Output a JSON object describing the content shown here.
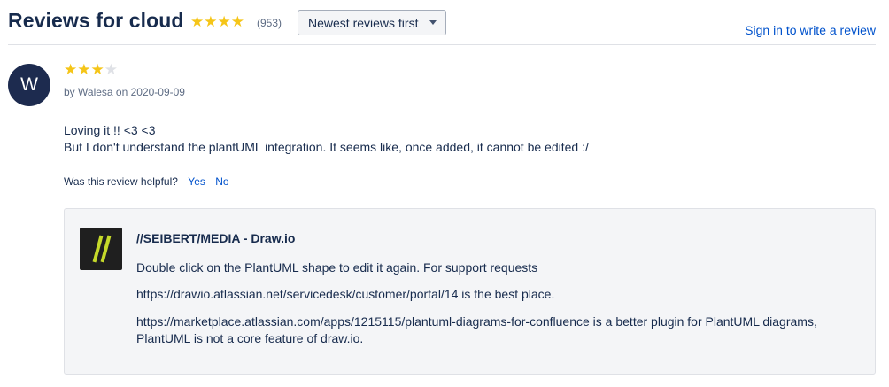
{
  "header": {
    "title": "Reviews for cloud",
    "stars": "★★★★",
    "count": "(953)",
    "sort": {
      "selected": "Newest reviews first"
    },
    "signin_label": "Sign in to write a review"
  },
  "review": {
    "avatar_initial": "W",
    "rating": 3,
    "rating_max": 4,
    "stars_on": "★★★",
    "stars_off": "★",
    "byline": "by Walesa on 2020-09-09",
    "body_line1": "Loving it !! <3 <3",
    "body_line2": "But I don't understand the plantUML integration. It seems like, once added, it cannot be edited :/",
    "helpful_prompt": "Was this review helpful?",
    "yes_label": "Yes",
    "no_label": "No"
  },
  "reply": {
    "vendor_name": "//SEIBERT/MEDIA - Draw.io",
    "paragraph1": "Double click on the PlantUML shape to edit it again. For support requests",
    "paragraph2": "https://drawio.atlassian.net/servicedesk/customer/portal/14 is the best place.",
    "paragraph3_line1": "https://marketplace.atlassian.com/apps/1215115/plantuml-diagrams-for-confluence is a better plugin for PlantUML diagrams,",
    "paragraph3_line2": "PlantUML is not a core feature of draw.io."
  },
  "colors": {
    "star": "#f5c518",
    "link": "#0052cc",
    "avatar_bg": "#1d2b4f",
    "reply_bg": "#f4f5f7",
    "logo_slash": "#c5d92a"
  }
}
